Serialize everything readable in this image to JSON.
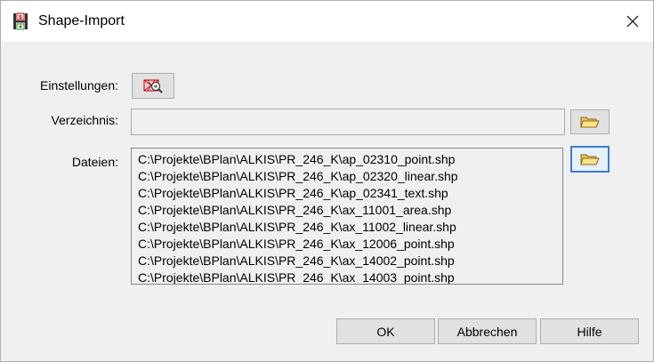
{
  "window": {
    "title": "Shape-Import"
  },
  "form": {
    "settings_label": "Einstellungen:",
    "directory_label": "Verzeichnis:",
    "directory_value": "",
    "files_label": "Dateien:"
  },
  "files": [
    "C:\\Projekte\\BPlan\\ALKIS\\PR_246_K\\ap_02310_point.shp",
    "C:\\Projekte\\BPlan\\ALKIS\\PR_246_K\\ap_02320_linear.shp",
    "C:\\Projekte\\BPlan\\ALKIS\\PR_246_K\\ap_02341_text.shp",
    "C:\\Projekte\\BPlan\\ALKIS\\PR_246_K\\ax_11001_area.shp",
    "C:\\Projekte\\BPlan\\ALKIS\\PR_246_K\\ax_11002_linear.shp",
    "C:\\Projekte\\BPlan\\ALKIS\\PR_246_K\\ax_12006_point.shp",
    "C:\\Projekte\\BPlan\\ALKIS\\PR_246_K\\ax_14002_point.shp",
    "C:\\Projekte\\BPlan\\ALKIS\\PR_246_K\\ax_14003_point.shp"
  ],
  "buttons": {
    "ok": "OK",
    "cancel": "Abbrechen",
    "help": "Hilfe"
  },
  "icons": {
    "app": "shape-app-icon",
    "settings": "settings-search-icon",
    "folder": "folder-open-icon",
    "close": "close-icon"
  },
  "colors": {
    "focus_border": "#3d7bd6",
    "dialog_bg": "#f0f0f0"
  }
}
